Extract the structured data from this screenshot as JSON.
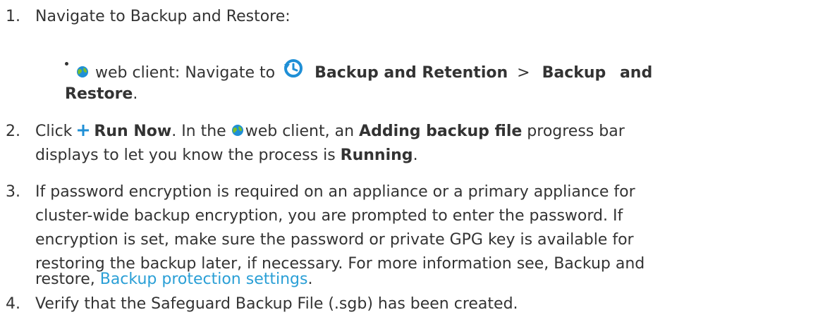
{
  "step1": {
    "number": "1.",
    "text": "Navigate to Backup and Restore:",
    "bullet": {
      "client_label": "web client: Navigate to",
      "bold_a": "Backup and Retention",
      "separator": ">",
      "bold_b_part1": "Backup and",
      "bold_b_part2": "Restore",
      "end_period": "."
    }
  },
  "step2": {
    "number": "2.",
    "click_label": "Click",
    "run_now": "Run Now",
    "text_a": ". In the",
    "text_b": "web client, an",
    "bold_adding": "Adding backup file",
    "text_c": "progress bar",
    "line2_a": "displays to let you know the process is",
    "bold_running": "Running",
    "line2_end": "."
  },
  "step3": {
    "number": "3.",
    "line1": "If password encryption is required on an appliance or a primary appliance for",
    "line2": "cluster-wide backup encryption, you are prompted to enter the password. If",
    "line3": "encryption is set, make sure the password or private GPG key is available for",
    "line4": "restoring the backup later, if necessary. For more information see, Backup and",
    "line5_a": "restore,",
    "link": "Backup protection settings",
    "line5_end": "."
  },
  "step4": {
    "number": "4.",
    "text": "Verify that the Safeguard Backup File (.sgb) has been created."
  },
  "colors": {
    "text": "#333333",
    "link": "#2a9fd6",
    "icon_blue": "#1f8fd6",
    "globe_green": "#7bbf2a"
  },
  "icons": {
    "globe": "globe-icon",
    "history": "history-icon",
    "plus": "plus-icon"
  }
}
